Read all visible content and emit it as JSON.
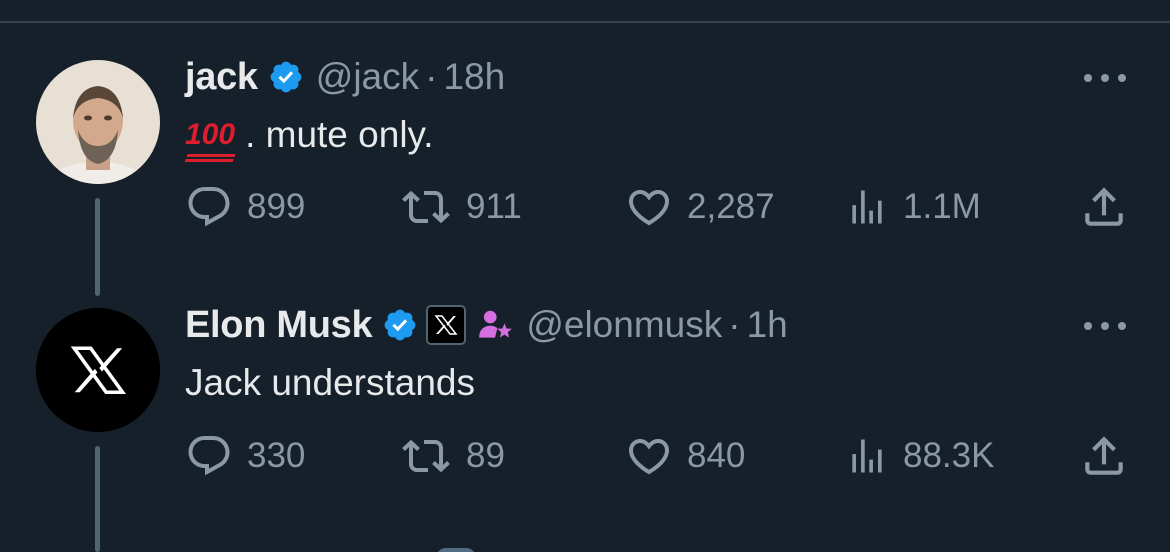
{
  "colors": {
    "background": "#15202b",
    "text_primary": "#e7e9ea",
    "text_secondary": "#8b98a5",
    "verified_blue": "#1d9bf0",
    "divider": "#38444d",
    "thread_line": "#536471",
    "affiliate_purple": "#d56fe0"
  },
  "tweets": [
    {
      "display_name": "jack",
      "verified": true,
      "handle": "@jack",
      "separator": "·",
      "time": "18h",
      "text_emoji": "100",
      "text": ". mute only.",
      "avatar_icon": "person-photo-avatar",
      "actions": {
        "replies": "899",
        "retweets": "911",
        "likes": "2,287",
        "views": "1.1M"
      }
    },
    {
      "display_name": "Elon Musk",
      "verified": true,
      "affiliate_badge": "x-logo-badge",
      "affiliate_extra_icon": "person-star-icon",
      "handle": "@elonmusk",
      "separator": "·",
      "time": "1h",
      "text": "Jack understands",
      "avatar_icon": "x-logo-avatar",
      "actions": {
        "replies": "330",
        "retweets": "89",
        "likes": "840",
        "views": "88.3K"
      }
    }
  ],
  "icons": {
    "reply": "reply-icon",
    "retweet": "retweet-icon",
    "like": "heart-icon",
    "views": "views-chart-icon",
    "share": "share-icon",
    "more": "more-dots-icon",
    "verified": "verified-check-icon"
  }
}
